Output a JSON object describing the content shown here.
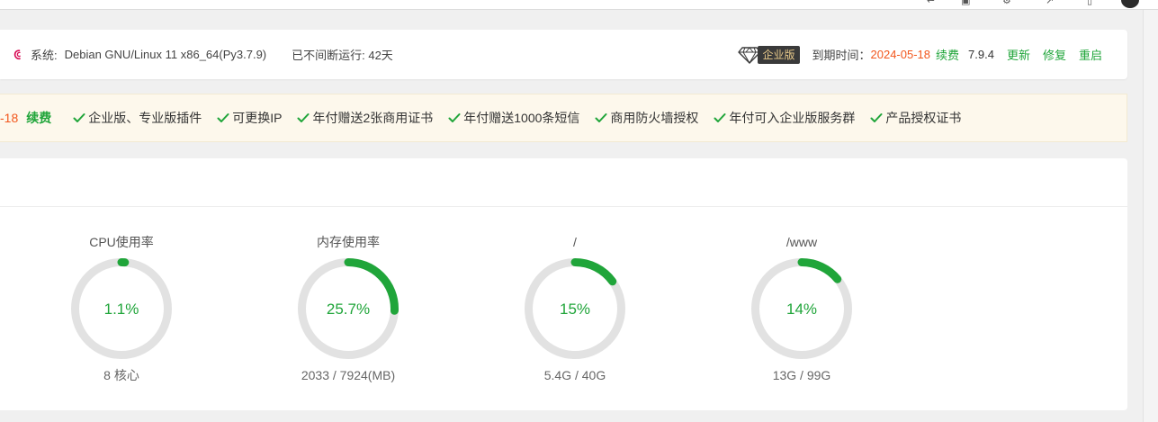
{
  "browser": {
    "toolbar_icons": [
      "reader-icon",
      "back-icon",
      "collections-icon",
      "extensions-icon",
      "share-icon",
      "sidebar-icon",
      "profile-avatar"
    ]
  },
  "system": {
    "os_label": "系统:",
    "os_value": "Debian GNU/Linux 11 x86_64(Py3.7.9)",
    "uptime": "已不间断运行: 42天",
    "edition_badge": "企业版",
    "expiry_label": "到期时间：",
    "expiry_date": "2024-05-18",
    "renew": "续费",
    "version": "7.9.4",
    "actions": [
      "更新",
      "修复",
      "重启"
    ]
  },
  "promo": {
    "date_fragment": "-18",
    "renew": "续费",
    "features": [
      "企业版、专业版插件",
      "可更换IP",
      "年付赠送2张商用证书",
      "年付赠送1000条短信",
      "商用防火墙授权",
      "年付可入企业版服务群",
      "产品授权证书"
    ]
  },
  "gauges": [
    {
      "title": "CPU使用率",
      "percent_text": "1.1%",
      "value": 1.1,
      "sub": "8 核心"
    },
    {
      "title": "内存使用率",
      "percent_text": "25.7%",
      "value": 25.7,
      "sub": "2033 / 7924(MB)"
    },
    {
      "title": "/",
      "percent_text": "15%",
      "value": 15,
      "sub": "5.4G / 40G"
    },
    {
      "title": "/www",
      "percent_text": "14%",
      "value": 14,
      "sub": "13G / 99G"
    }
  ],
  "colors": {
    "accent_green": "#20a53a",
    "date_orange": "#f2571d",
    "gauge_track": "#e2e2e2"
  }
}
